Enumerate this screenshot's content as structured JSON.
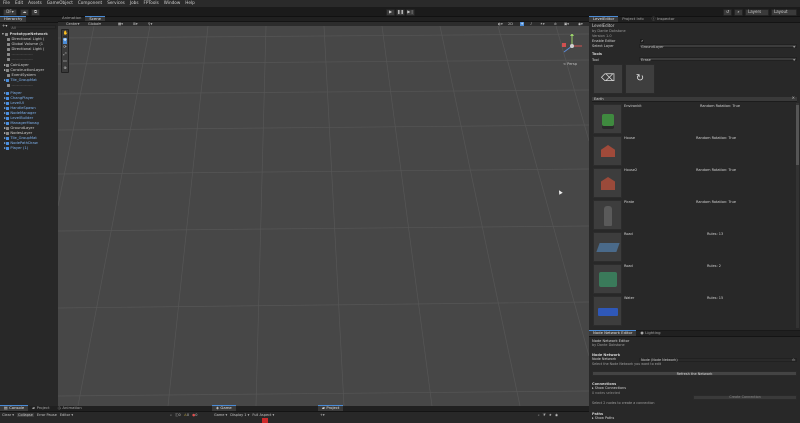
{
  "menu": [
    "File",
    "Edit",
    "Assets",
    "GameObject",
    "Component",
    "Services",
    "Jobs",
    "FPTools",
    "Window",
    "Help"
  ],
  "toolbar": {
    "account": "DF",
    "layers": "Layers",
    "layout": "Layout"
  },
  "hierarchy": {
    "tab": "Hierarchy",
    "search_placeholder": "All",
    "root": "PrototypeNetwork",
    "items": [
      {
        "label": "Directional Light (",
        "blue": false
      },
      {
        "label": "Global Volume (1",
        "blue": false
      },
      {
        "label": "Directional Light (",
        "blue": false
      },
      {
        "label": "----------------",
        "blue": false
      },
      {
        "label": "----------------",
        "blue": false
      },
      {
        "label": "CoinLayer",
        "blue": false
      },
      {
        "label": "ConstructionLayer",
        "blue": false
      },
      {
        "label": "EventSystem",
        "blue": false
      },
      {
        "label": "Tile_GroupMat",
        "blue": true
      },
      {
        "label": "----------------",
        "blue": false
      },
      {
        "label": "Player",
        "blue": true
      },
      {
        "label": "ChangPlayer",
        "blue": true
      },
      {
        "label": "LevelUI",
        "blue": true
      },
      {
        "label": "HandleSpawn",
        "blue": true
      },
      {
        "label": "NodeManager",
        "blue": true
      },
      {
        "label": "LevelBuilder",
        "blue": true
      },
      {
        "label": "ManagerManag",
        "blue": true
      },
      {
        "label": "GroundLayer",
        "blue": false
      },
      {
        "label": "NodesLayer",
        "blue": false
      },
      {
        "label": "Tile_GroupMat",
        "blue": true
      },
      {
        "label": "NodePathDraw",
        "blue": true
      },
      {
        "label": "Player (1)",
        "blue": true
      }
    ]
  },
  "scene": {
    "tabs": [
      "Animation",
      "Scene"
    ],
    "shading": "Center",
    "pivot": "Global",
    "gizmo_label": "< Persp"
  },
  "right_tabs": [
    "LevelEditor",
    "Project Info",
    "Inspector"
  ],
  "level_editor": {
    "title": "LevelEditor",
    "by": "by Dante Dokstone",
    "version": "Version 1.0",
    "enable_label": "Enable Editor",
    "select_layer_label": "Select Layer",
    "select_layer_value": "GroundLayer",
    "tools_label": "Tools",
    "tool_label": "Tool",
    "tool_value": "Erase",
    "group": "Earth",
    "tiles": [
      {
        "name": "Environkit",
        "prop": "Random Rotation: True",
        "color": "#3f8a3f"
      },
      {
        "name": "House",
        "prop": "Random Rotation: True",
        "color": "#a04a3a"
      },
      {
        "name": "House2",
        "prop": "Random Rotation: True",
        "color": "#9a4a3a"
      },
      {
        "name": "Pirate",
        "prop": "Random Rotation: True",
        "color": "#5a5a5a"
      },
      {
        "name": "Road",
        "prop": "Rules: 13",
        "color": "#4a6a8a"
      },
      {
        "name": "Road",
        "prop": "Rules: 2",
        "color": "#3a7a5a"
      },
      {
        "name": "Water",
        "prop": "Rules: 15",
        "color": "#2f58b8"
      }
    ]
  },
  "node_editor": {
    "tabs": [
      "Node Network Editor",
      "Lighting"
    ],
    "title": "Node Network Editor",
    "by": "by Dante Dokstone",
    "node_network_section": "Node Network",
    "node_network_label": "Node Network",
    "node_network_value": "Node (Node Network)",
    "hint": "Select the Node Network you want to edit",
    "refresh_button": "Refresh the Network",
    "connections_label": "Connections",
    "show_connections": "Show Connections",
    "selected_label": "0 nodes selected",
    "create_button": "Create Connection",
    "select_hint": "Select 2 nodes to create a connection",
    "paths_label": "Paths",
    "show_paths": "Show Paths"
  },
  "bottom": {
    "console_tabs": [
      "Console",
      "Project",
      "Animation"
    ],
    "console_buttons": [
      "Clear",
      "Collapse",
      "Error Pause",
      "Editor"
    ],
    "counts": [
      "0",
      "0",
      "0"
    ],
    "game_tab": "Game",
    "game_display": "Display 1",
    "game_aspect": "Full Aspect",
    "project_tab": "Project"
  }
}
